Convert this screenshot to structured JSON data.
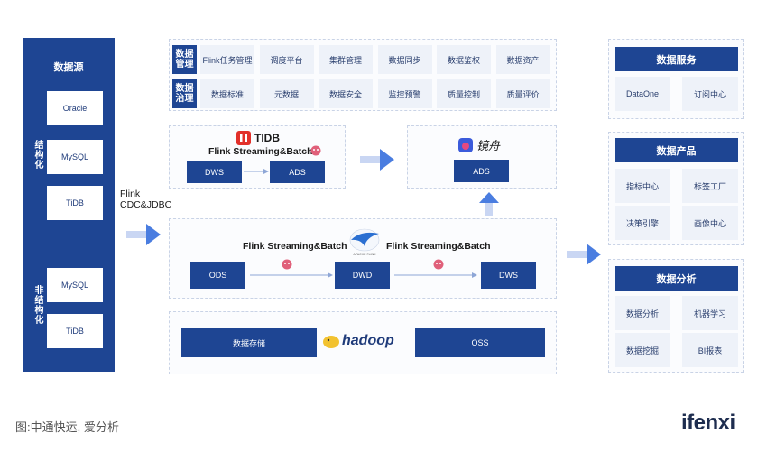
{
  "left": {
    "title": "数据源",
    "structured_label": "结构化",
    "unstructured_label": "非结构化",
    "structured_items": [
      "Oracle",
      "MySQL",
      "TiDB"
    ],
    "unstructured_items": [
      "MySQL",
      "TiDB"
    ]
  },
  "connector": {
    "line1": "Flink",
    "line2": "CDC&JDBC"
  },
  "governance": {
    "row1_header": "数据管理",
    "row1_items": [
      "Flink任务管理",
      "调度平台",
      "集群管理",
      "数据同步",
      "数据鉴权",
      "数据资产"
    ],
    "row2_header": "数据治理",
    "row2_items": [
      "数据标准",
      "元数据",
      "数据安全",
      "监控预警",
      "质量控制",
      "质量评价"
    ]
  },
  "tidb_box": {
    "logo_text": "TIDB",
    "stream_label": "Flink Streaming&Batch",
    "left": "DWS",
    "right": "ADS"
  },
  "jingzhou_box": {
    "logo_text": "镜舟",
    "ads": "ADS"
  },
  "pipeline": {
    "label_left": "Flink Streaming&Batch",
    "label_right": "Flink Streaming&Batch",
    "ods": "ODS",
    "dwd": "DWD",
    "dws": "DWS"
  },
  "storage": {
    "left": "数据存储",
    "logo_text": "hadoop",
    "right": "OSS"
  },
  "right": {
    "service": {
      "title": "数据服务",
      "items": [
        "DataOne",
        "订阅中心"
      ]
    },
    "product": {
      "title": "数据产品",
      "items": [
        "指标中心",
        "标签工厂",
        "决策引擎",
        "画像中心"
      ]
    },
    "analysis": {
      "title": "数据分析",
      "items": [
        "数据分析",
        "机器学习",
        "数据挖掘",
        "BI报表"
      ]
    }
  },
  "footer": {
    "caption": "图:中通快运, 爱分析",
    "brand": "ifenxi"
  },
  "colors": {
    "navy": "#1e4593",
    "arrow": "#4a7de0",
    "light": "#eef2f9"
  }
}
